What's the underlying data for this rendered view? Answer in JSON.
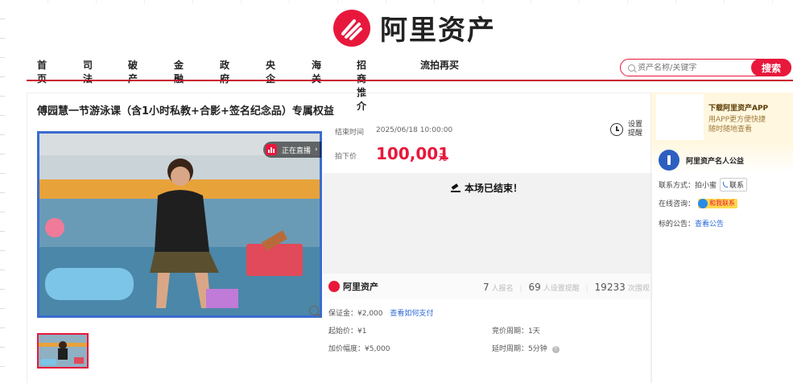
{
  "brand": {
    "name": "阿里资产",
    "color": "#e8183c",
    "logo_icon": "ali-assets-logo-icon"
  },
  "nav": {
    "items": [
      "首页",
      "司法",
      "破产",
      "金融",
      "政府",
      "央企",
      "海关",
      "招商推介",
      "流拍再买"
    ]
  },
  "search": {
    "placeholder": "资产名称/关键字",
    "button": "搜索"
  },
  "item": {
    "title": "傅园慧一节游泳课（含1小时私教+合影+签名纪念品）专属权益",
    "live_badge": "正在直播",
    "end_time_label": "结束时间",
    "end_time": "2025/06/18 10:00:00",
    "remind_label": "设置提醒",
    "price_label": "拍下价",
    "price": "100,001",
    "price_unit": "元",
    "ended_text": "本场已结束！"
  },
  "stats": {
    "brand": "阿里资产",
    "signups": "7",
    "signups_label": "人报名",
    "reminders": "69",
    "reminders_label": "人设置提醒",
    "views": "19233",
    "views_label": "次围观"
  },
  "details": {
    "deposit_label": "保证金：",
    "deposit": "¥2,000",
    "deposit_link": "查看如何支付",
    "start_price_label": "起始价：",
    "start_price": "¥1",
    "bid_period_label": "竞价周期：",
    "bid_period": "1天",
    "increment_label": "加价幅度：",
    "increment": "¥5,000",
    "delay_label": "延时周期：",
    "delay": "5分钟"
  },
  "sidebar": {
    "app_title": "下载阿里资产APP",
    "app_desc_1": "用APP更方便快捷",
    "app_desc_2": "随时随地查看",
    "seller": "阿里资产名人公益",
    "contact_label": "联系方式：",
    "contact_name": "拍小蜜",
    "contact_btn": "联系",
    "consult_label": "在线咨询：",
    "consult_btn": "和我联系",
    "notice_label": "标的公告：",
    "notice_link": "查看公告"
  }
}
